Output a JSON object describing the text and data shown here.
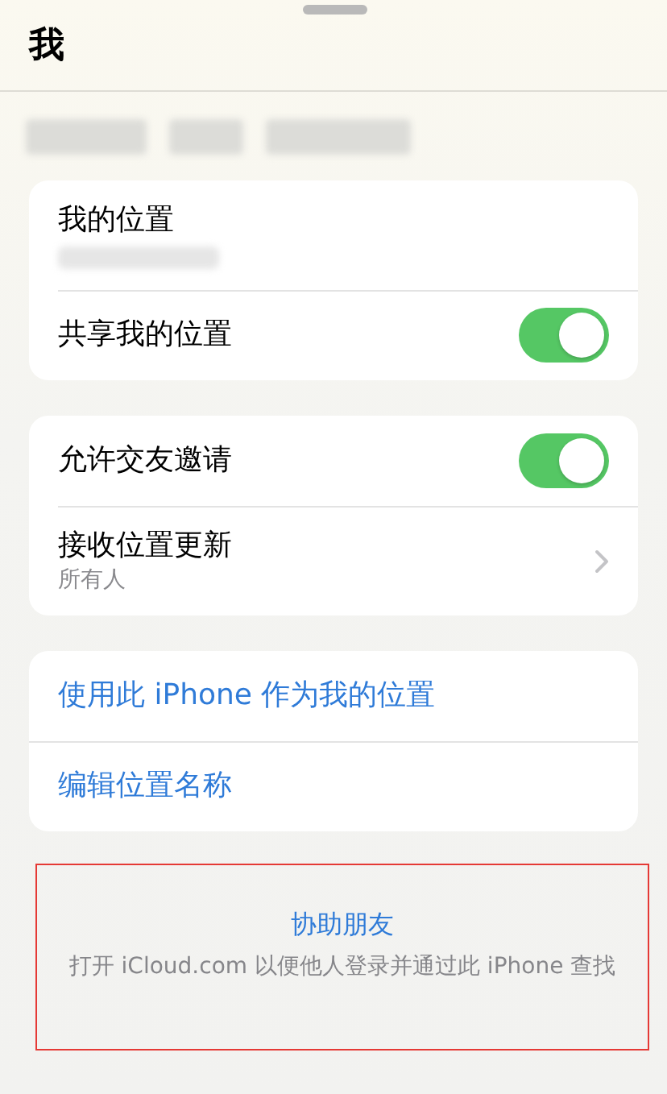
{
  "header": {
    "title": "我"
  },
  "groups": [
    {
      "rows": [
        {
          "kind": "redacted",
          "label": "我的位置"
        },
        {
          "kind": "toggle",
          "label": "共享我的位置",
          "on": true
        }
      ]
    },
    {
      "rows": [
        {
          "kind": "toggle",
          "label": "允许交友邀请",
          "on": true
        },
        {
          "kind": "disclosure",
          "label": "接收位置更新",
          "subtitle": "所有人"
        }
      ]
    },
    {
      "rows": [
        {
          "kind": "action",
          "label": "使用此 iPhone 作为我的位置"
        },
        {
          "kind": "action",
          "label": "编辑位置名称"
        }
      ]
    }
  ],
  "help": {
    "title": "协助朋友",
    "description": "打开 iCloud.com 以便他人登录并通过此 iPhone 查找",
    "highlighted": true
  }
}
